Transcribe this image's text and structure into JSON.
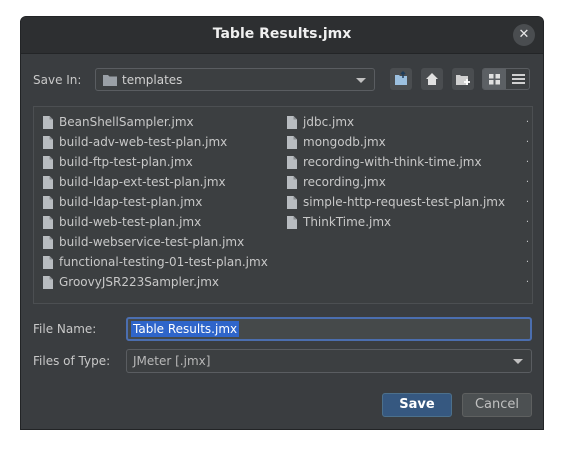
{
  "dialog": {
    "title": "Table Results.jmx",
    "close_glyph": "✕"
  },
  "toolbar": {
    "save_in_label": "Save In:",
    "folder": "templates"
  },
  "files": {
    "col1": [
      "BeanShellSampler.jmx",
      "build-adv-web-test-plan.jmx",
      "build-ftp-test-plan.jmx",
      "build-ldap-ext-test-plan.jmx",
      "build-ldap-test-plan.jmx",
      "build-web-test-plan.jmx",
      "build-webservice-test-plan.jmx",
      "functional-testing-01-test-plan.jmx",
      "GroovyJSR223Sampler.jmx"
    ],
    "col2": [
      "jdbc.jmx",
      "mongodb.jmx",
      "recording-with-think-time.jmx",
      "recording.jmx",
      "simple-http-request-test-plan.jmx",
      "ThinkTime.jmx"
    ],
    "dots": [
      ".",
      ".",
      ".",
      ".",
      ".",
      ".",
      ".",
      ".",
      "."
    ]
  },
  "file_name": {
    "label": "File Name:",
    "value": "Table Results.jmx"
  },
  "file_type": {
    "label": "Files of Type:",
    "value": "JMeter [.jmx]"
  },
  "buttons": {
    "save": "Save",
    "cancel": "Cancel"
  },
  "colors": {
    "accent": "#4b6eaf",
    "selection": "#2f65ca",
    "background": "#3a3d40"
  }
}
